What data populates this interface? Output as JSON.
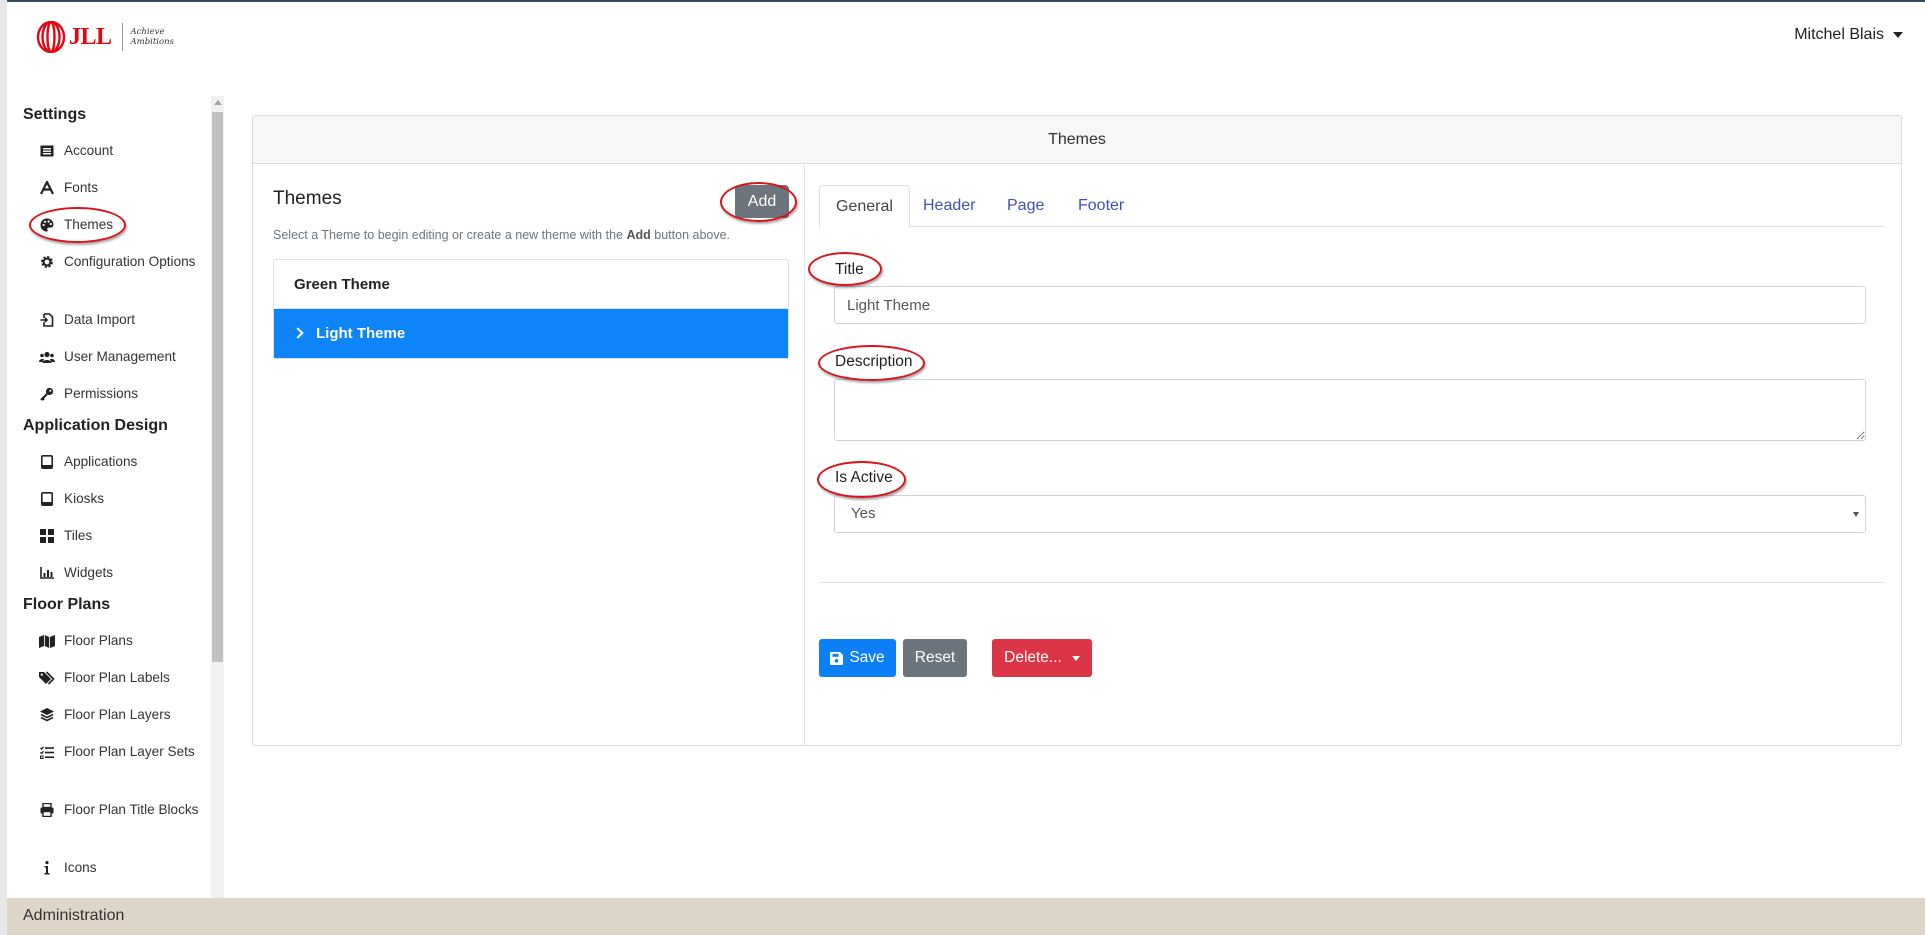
{
  "header": {
    "logo_text": "JLL",
    "logo_tagline": "Achieve Ambitions",
    "user_name": "Mitchel Blais"
  },
  "sidebar": {
    "sections": [
      {
        "title": "Settings",
        "items": [
          {
            "label": "Account",
            "icon": "account-card-icon"
          },
          {
            "label": "Fonts",
            "icon": "font-icon"
          },
          {
            "label": "Themes",
            "icon": "palette-icon"
          },
          {
            "label": "Configuration Options",
            "icon": "gear-icon"
          },
          {
            "label": "Data Import",
            "icon": "file-import-icon"
          },
          {
            "label": "User Management",
            "icon": "users-icon"
          },
          {
            "label": "Permissions",
            "icon": "key-icon"
          }
        ]
      },
      {
        "title": "Application Design",
        "items": [
          {
            "label": "Applications",
            "icon": "tablet-icon"
          },
          {
            "label": "Kiosks",
            "icon": "tablet-icon"
          },
          {
            "label": "Tiles",
            "icon": "tiles-icon"
          },
          {
            "label": "Widgets",
            "icon": "chart-icon"
          }
        ]
      },
      {
        "title": "Floor Plans",
        "items": [
          {
            "label": "Floor Plans",
            "icon": "map-icon"
          },
          {
            "label": "Floor Plan Labels",
            "icon": "tags-icon"
          },
          {
            "label": "Floor Plan Layers",
            "icon": "layers-icon"
          },
          {
            "label": "Floor Plan Layer Sets",
            "icon": "tasks-icon"
          },
          {
            "label": "Floor Plan Title Blocks",
            "icon": "print-icon"
          },
          {
            "label": "Icons",
            "icon": "info-icon"
          }
        ]
      }
    ],
    "footer_label": "Administration"
  },
  "card": {
    "title": "Themes",
    "list_title": "Themes",
    "add_label": "Add",
    "help_prefix": "Select a Theme to begin editing or create a new theme with the",
    "help_bold": "Add",
    "help_suffix": "button above.",
    "themes": [
      "Green Theme",
      "Light Theme"
    ],
    "selected_theme": "Light Theme"
  },
  "editor": {
    "tabs": [
      "General",
      "Header",
      "Page",
      "Footer"
    ],
    "active_tab": "General",
    "title_label": "Title",
    "title_value": "Light Theme",
    "description_label": "Description",
    "description_value": "",
    "active_label": "Is Active",
    "active_value": "Yes",
    "save_label": "Save",
    "reset_label": "Reset",
    "delete_label": "Delete..."
  },
  "colors": {
    "annotation": "#d9141b",
    "primary": "#0d84f7",
    "secondary": "#6c757d",
    "danger": "#dc3545",
    "brand_red": "#e30613",
    "footer_bg": "#ddd6c8"
  }
}
